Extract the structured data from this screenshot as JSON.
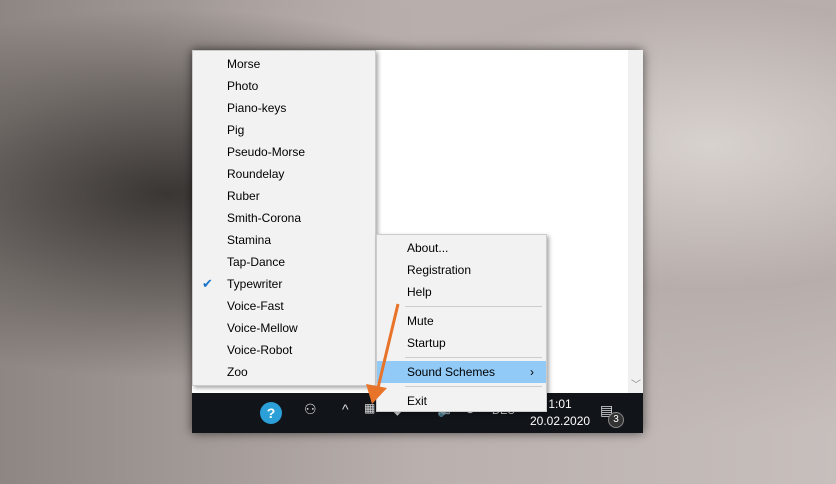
{
  "schemes_menu": {
    "items": [
      "Morse",
      "Photo",
      "Piano-keys",
      "Pig",
      "Pseudo-Morse",
      "Roundelay",
      "Ruber",
      "Smith-Corona",
      "Stamina",
      "Tap-Dance",
      "Typewriter",
      "Voice-Fast",
      "Voice-Mellow",
      "Voice-Robot",
      "Zoo"
    ],
    "checked": "Typewriter"
  },
  "context_menu": {
    "about": "About...",
    "registration": "Registration",
    "help": "Help",
    "mute": "Mute",
    "startup": "Startup",
    "sound_schemes": "Sound Schemes",
    "exit": "Exit"
  },
  "taskbar": {
    "language": "DEU",
    "time": "1:01",
    "date": "20.02.2020",
    "notifications": "3"
  },
  "colors": {
    "highlight": "#91c9f7",
    "arrow": "#e8742a"
  }
}
